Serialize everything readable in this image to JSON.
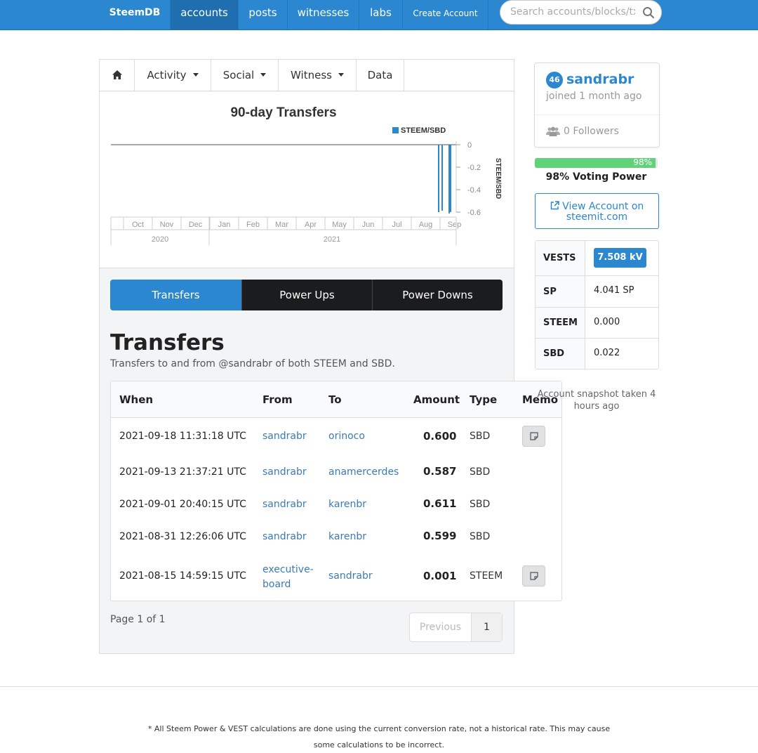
{
  "navbar": {
    "brand": "SteemDB",
    "items": [
      "accounts",
      "posts",
      "witnesses",
      "labs"
    ],
    "create_account": "Create Account",
    "search_placeholder": "Search accounts/blocks/tx"
  },
  "menu": {
    "activity": "Activity",
    "social": "Social",
    "witness": "Witness",
    "data": "Data"
  },
  "chart_data": {
    "type": "bar",
    "title": "90-day Transfers",
    "legend": [
      "STEEM/SBD"
    ],
    "ylabel": "STEEM/SBD",
    "y_ticks": [
      "0",
      "-0.2",
      "-0.4",
      "-0.6"
    ],
    "ylim": [
      -0.6,
      0
    ],
    "x_ticks": [
      "Oct",
      "Nov",
      "Dec",
      "Jan",
      "Feb",
      "Mar",
      "Apr",
      "May",
      "Jun",
      "Jul",
      "Aug",
      "Sep"
    ],
    "year_labels": [
      "2020",
      "2021"
    ],
    "series": [
      {
        "name": "STEEM/SBD",
        "values": [
          -0.6,
          -0.587,
          -0.611,
          -0.599
        ]
      }
    ]
  },
  "tabs": [
    "Transfers",
    "Power Ups",
    "Power Downs"
  ],
  "section": {
    "title": "Transfers",
    "subtitle": "Transfers to and from @sandrabr of both STEEM and SBD."
  },
  "table": {
    "headers": [
      "When",
      "From",
      "To",
      "Amount",
      "Type",
      "Memo"
    ],
    "rows": [
      {
        "when": "2021-09-18 11:31:18 UTC",
        "from": "sandrabr",
        "to": "orinoco",
        "amount": "0.600",
        "type": "SBD",
        "memo": true
      },
      {
        "when": "2021-09-13 21:37:21 UTC",
        "from": "sandrabr",
        "to": "anamercerdes",
        "amount": "0.587",
        "type": "SBD",
        "memo": false
      },
      {
        "when": "2021-09-01 20:40:15 UTC",
        "from": "sandrabr",
        "to": "karenbr",
        "amount": "0.611",
        "type": "SBD",
        "memo": false
      },
      {
        "when": "2021-08-31 12:26:06 UTC",
        "from": "sandrabr",
        "to": "karenbr",
        "amount": "0.599",
        "type": "SBD",
        "memo": false
      },
      {
        "when": "2021-08-15 14:59:15 UTC",
        "from_line1": "executive-",
        "from_line2": "board",
        "to": "sandrabr",
        "amount": "0.001",
        "type": "STEEM",
        "memo": true
      }
    ]
  },
  "pagination": {
    "info": "Page 1 of 1",
    "previous": "Previous",
    "current": "1"
  },
  "profile": {
    "reputation": "46",
    "username": "sandrabr",
    "joined": "joined 1 month ago",
    "followers": "0 Followers"
  },
  "voting": {
    "percent": 98,
    "percent_label": "98%",
    "label": "98% Voting Power"
  },
  "view_account": {
    "line1": "View Account on",
    "line2": "steemit.com"
  },
  "balances": {
    "vests_label": "VESTS",
    "vests_value": "7.508 kV",
    "sp_label": "SP",
    "sp_value": "4.041 SP",
    "steem_label": "STEEM",
    "steem_value": "0.000",
    "sbd_label": "SBD",
    "sbd_value": "0.022"
  },
  "snapshot": "Account snapshot taken 4 hours ago",
  "footer": "* All Steem Power & VEST calculations are done using the current conversion rate, not a historical rate. This may cause some calculations to be incorrect.",
  "colors": {
    "primary": "#2a87d0",
    "dark_tab": "#1b1c1d",
    "voting_green": "#62d27a",
    "link": "#3b7bb5"
  }
}
